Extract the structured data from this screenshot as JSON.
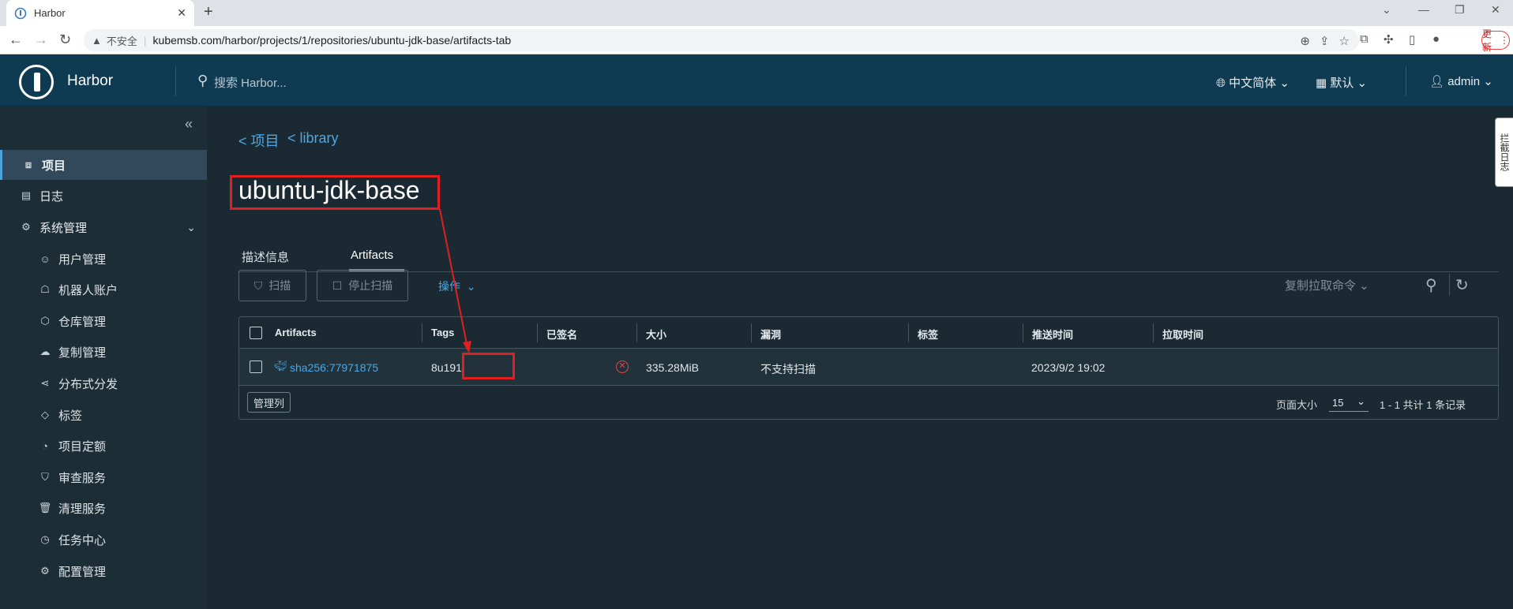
{
  "browser": {
    "tab_title": "Harbor",
    "insecure_label": "不安全",
    "url": "kubemsb.com/harbor/projects/1/repositories/ubuntu-jdk-base/artifacts-tab",
    "update_label": "更新"
  },
  "header": {
    "brand": "Harbor",
    "search_placeholder": "搜索 Harbor...",
    "language": "中文简体",
    "theme": "默认",
    "user": "admin"
  },
  "sidebar": {
    "items": [
      {
        "label": "项目",
        "icon": "projects-icon",
        "active": true
      },
      {
        "label": "日志",
        "icon": "logs-icon"
      },
      {
        "label": "系统管理",
        "icon": "admin-icon"
      }
    ],
    "sub_items": [
      {
        "label": "用户管理",
        "icon": "users-icon"
      },
      {
        "label": "机器人账户",
        "icon": "robot-icon"
      },
      {
        "label": "仓库管理",
        "icon": "registry-icon"
      },
      {
        "label": "复制管理",
        "icon": "replication-icon"
      },
      {
        "label": "分布式分发",
        "icon": "distribution-icon"
      },
      {
        "label": "标签",
        "icon": "tag-icon"
      },
      {
        "label": "项目定额",
        "icon": "quota-icon"
      },
      {
        "label": "审查服务",
        "icon": "shield-icon"
      },
      {
        "label": "清理服务",
        "icon": "trash-icon"
      },
      {
        "label": "任务中心",
        "icon": "dashboard-icon"
      },
      {
        "label": "配置管理",
        "icon": "gear-icon"
      }
    ]
  },
  "main": {
    "breadcrumb": [
      "< 项目",
      "< library"
    ],
    "title": "ubuntu-jdk-base",
    "tabs": [
      {
        "label": "描述信息"
      },
      {
        "label": "Artifacts",
        "active": true
      }
    ],
    "toolbar": {
      "scan": "扫描",
      "stop_scan": "停止扫描",
      "actions": "操作",
      "copy_pull": "复制拉取命令"
    },
    "table": {
      "columns": [
        "Artifacts",
        "Tags",
        "已签名",
        "大小",
        "漏洞",
        "标签",
        "推送时间",
        "拉取时间"
      ],
      "rows": [
        {
          "artifact": "sha256:77971875",
          "tags": "8u191",
          "signed": "unsigned",
          "size": "335.28MiB",
          "vulnerability": "不支持扫描",
          "labels": "",
          "push_time": "2023/9/2 19:02",
          "pull_time": ""
        }
      ]
    },
    "footer": {
      "manage_columns": "管理列",
      "page_size_label": "页面大小",
      "page_size": "15",
      "total": "1 - 1 共计 1 条记录"
    }
  },
  "side_widget": "拦截日志",
  "colors": {
    "header_bg": "#0e3a52",
    "sidebar_bg": "#1d2d35",
    "main_bg": "#1b2a32",
    "link": "#4aa8e6",
    "annotation": "#e02020"
  }
}
